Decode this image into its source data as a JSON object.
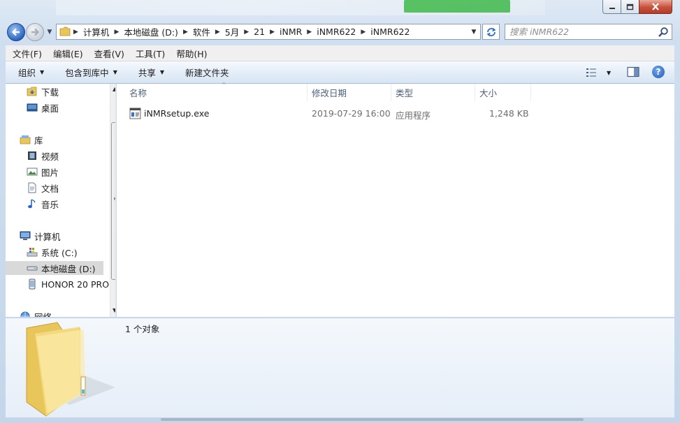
{
  "window": {
    "minimize_icon": "minimize-icon",
    "maximize_icon": "maximize-icon",
    "close_icon": "close-icon"
  },
  "address_bar": {
    "breadcrumbs": [
      "计算机",
      "本地磁盘 (D:)",
      "软件",
      "5月",
      "21",
      "iNMR",
      "iNMR622",
      "iNMR622"
    ]
  },
  "search": {
    "placeholder": "搜索 iNMR622"
  },
  "menu": {
    "file": "文件(F)",
    "edit": "编辑(E)",
    "view": "查看(V)",
    "tools": "工具(T)",
    "help": "帮助(H)"
  },
  "toolbar": {
    "organize": "组织",
    "include_in_library": "包含到库中",
    "share": "共享",
    "new_folder": "新建文件夹"
  },
  "nav": {
    "downloads": "下载",
    "desktop": "桌面",
    "libraries": "库",
    "videos": "视频",
    "pictures": "图片",
    "documents": "文档",
    "music": "音乐",
    "computer": "计算机",
    "drive_c": "系统 (C:)",
    "drive_d": "本地磁盘 (D:)",
    "phone": "HONOR 20 PRO",
    "network": "网络"
  },
  "columns": {
    "name": "名称",
    "date": "修改日期",
    "type": "类型",
    "size": "大小"
  },
  "files": [
    {
      "name": "iNMRsetup.exe",
      "date": "2019-07-29 16:00",
      "type": "应用程序",
      "size": "1,248 KB"
    }
  ],
  "details": {
    "count": "1 个对象"
  },
  "colors": {
    "accent": "#2a67c4",
    "selection": "#d9d9d9",
    "header_text": "#4c607a",
    "folder": "#f2d36b"
  }
}
